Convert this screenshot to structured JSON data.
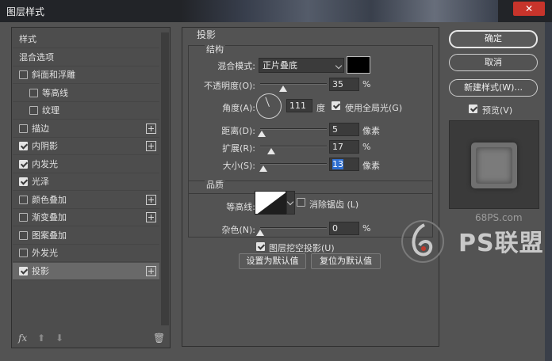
{
  "window": {
    "title": "图层样式",
    "close_glyph": "✕"
  },
  "left_panel": {
    "items": [
      {
        "label": "样式",
        "checkbox": false,
        "checked": false,
        "plus": false,
        "selected": false,
        "indent": 0
      },
      {
        "label": "混合选项",
        "checkbox": false,
        "checked": false,
        "plus": false,
        "selected": false,
        "indent": 0
      },
      {
        "label": "斜面和浮雕",
        "checkbox": true,
        "checked": false,
        "plus": false,
        "selected": false,
        "indent": 0
      },
      {
        "label": "等高线",
        "checkbox": true,
        "checked": false,
        "plus": false,
        "selected": false,
        "indent": 1
      },
      {
        "label": "纹理",
        "checkbox": true,
        "checked": false,
        "plus": false,
        "selected": false,
        "indent": 1
      },
      {
        "label": "描边",
        "checkbox": true,
        "checked": false,
        "plus": true,
        "selected": false,
        "indent": 0
      },
      {
        "label": "内阴影",
        "checkbox": true,
        "checked": true,
        "plus": true,
        "selected": false,
        "indent": 0
      },
      {
        "label": "内发光",
        "checkbox": true,
        "checked": true,
        "plus": false,
        "selected": false,
        "indent": 0
      },
      {
        "label": "光泽",
        "checkbox": true,
        "checked": true,
        "plus": false,
        "selected": false,
        "indent": 0
      },
      {
        "label": "颜色叠加",
        "checkbox": true,
        "checked": false,
        "plus": true,
        "selected": false,
        "indent": 0
      },
      {
        "label": "渐变叠加",
        "checkbox": true,
        "checked": false,
        "plus": true,
        "selected": false,
        "indent": 0
      },
      {
        "label": "图案叠加",
        "checkbox": true,
        "checked": false,
        "plus": false,
        "selected": false,
        "indent": 0
      },
      {
        "label": "外发光",
        "checkbox": true,
        "checked": false,
        "plus": false,
        "selected": false,
        "indent": 0
      },
      {
        "label": "投影",
        "checkbox": true,
        "checked": true,
        "plus": true,
        "selected": true,
        "indent": 0
      }
    ],
    "footer": {
      "fx": "fx",
      "up_glyph": "⬆",
      "down_glyph": "⬇",
      "trash_glyph": "🗑"
    }
  },
  "drop_shadow": {
    "heading": "投影",
    "structure": {
      "heading": "结构",
      "blend_mode_label": "混合模式:",
      "blend_mode_value": "正片叠底",
      "shadow_color": "#000000",
      "opacity_label": "不透明度(O):",
      "opacity_value": "35",
      "opacity_unit": "%",
      "opacity_fraction": 0.35,
      "angle_label": "角度(A):",
      "angle_value": "111",
      "angle_unit": "度",
      "global_light_label": "使用全局光(G)",
      "global_light_checked": true,
      "distance_label": "距离(D):",
      "distance_value": "5",
      "distance_unit": "像素",
      "distance_fraction": 0.02,
      "spread_label": "扩展(R):",
      "spread_value": "17",
      "spread_unit": "%",
      "spread_fraction": 0.17,
      "size_label": "大小(S):",
      "size_value": "13",
      "size_unit": "像素",
      "size_fraction": 0.05
    },
    "quality": {
      "heading": "品质",
      "contour_label": "等高线:",
      "antialias_label": "消除锯齿 (L)",
      "antialias_checked": false,
      "noise_label": "杂色(N):",
      "noise_value": "0",
      "noise_unit": "%",
      "noise_fraction": 0
    },
    "knockout_label": "图层挖空投影(U)",
    "knockout_checked": true,
    "make_default_label": "设置为默认值",
    "reset_default_label": "复位为默认值"
  },
  "right_panel": {
    "ok_label": "确定",
    "cancel_label": "取消",
    "new_style_label": "新建样式(W)...",
    "preview_label": "预览(V)",
    "preview_checked": true
  },
  "watermark": {
    "site": "68PS.com",
    "logo_text": "PS联盟"
  }
}
